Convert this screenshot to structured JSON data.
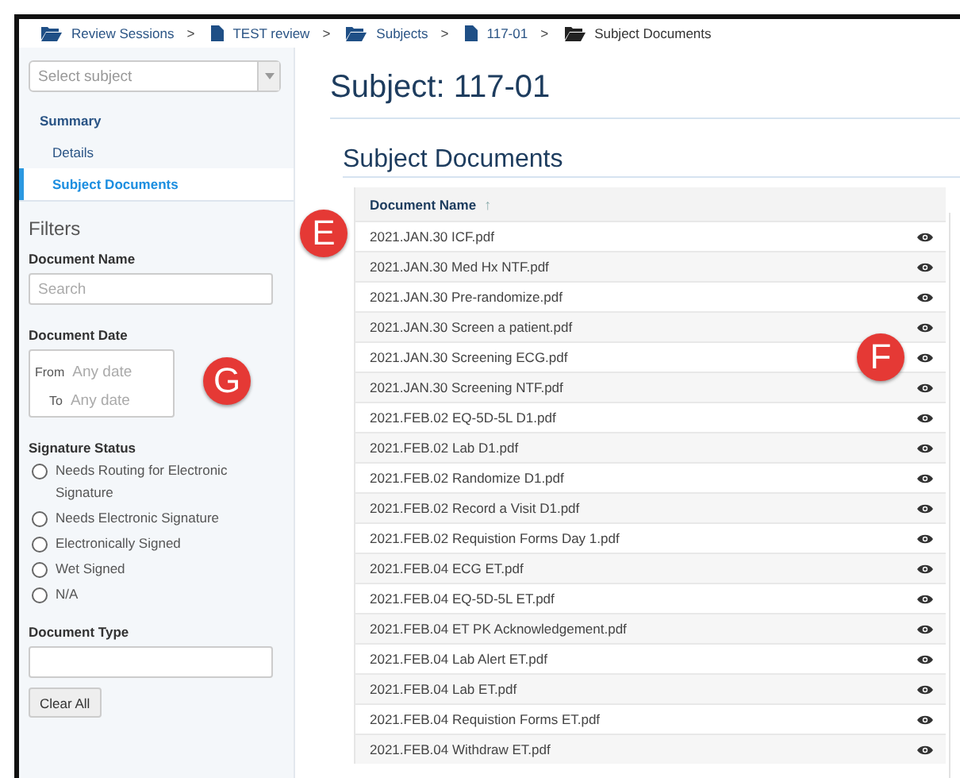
{
  "breadcrumbs": [
    {
      "label": "Review Sessions",
      "kind": "folder"
    },
    {
      "label": "TEST review",
      "kind": "file"
    },
    {
      "label": "Subjects",
      "kind": "folder"
    },
    {
      "label": "117-01",
      "kind": "file"
    },
    {
      "label": "Subject Documents",
      "kind": "current"
    }
  ],
  "separator": ">",
  "sidebar": {
    "subject_select": {
      "placeholder": "Select subject"
    },
    "nav": [
      {
        "label": "Summary",
        "kind": "heading",
        "selected": false
      },
      {
        "label": "Details",
        "kind": "item",
        "selected": false
      },
      {
        "label": "Subject Documents",
        "kind": "item",
        "selected": true
      }
    ],
    "filters_title": "Filters",
    "document_name": {
      "label": "Document Name",
      "placeholder": "Search"
    },
    "document_date": {
      "label": "Document Date",
      "from_label": "From",
      "from_placeholder": "Any date",
      "to_label": "To",
      "to_placeholder": "Any date"
    },
    "signature_status": {
      "label": "Signature Status",
      "options": [
        {
          "label": "Needs Routing for Electronic Signature",
          "selected": false
        },
        {
          "label": "Needs Electronic Signature",
          "selected": false
        },
        {
          "label": "Electronically Signed",
          "selected": false
        },
        {
          "label": "Wet Signed",
          "selected": false
        },
        {
          "label": "N/A",
          "selected": false
        }
      ]
    },
    "document_type": {
      "label": "Document Type"
    },
    "clear_button": "Clear All"
  },
  "main": {
    "title": "Subject: 117-01",
    "section_title": "Subject Documents",
    "table": {
      "columns": [
        "Document Name"
      ],
      "sort_icon": "↑",
      "rows": [
        "2021.JAN.30 ICF.pdf",
        "2021.JAN.30 Med Hx NTF.pdf",
        "2021.JAN.30 Pre-randomize.pdf",
        "2021.JAN.30 Screen a patient.pdf",
        "2021.JAN.30 Screening ECG.pdf",
        "2021.JAN.30 Screening NTF.pdf",
        "2021.FEB.02 EQ-5D-5L D1.pdf",
        "2021.FEB.02 Lab D1.pdf",
        "2021.FEB.02 Randomize D1.pdf",
        "2021.FEB.02 Record a Visit D1.pdf",
        "2021.FEB.02 Requistion Forms Day 1.pdf",
        "2021.FEB.04 ECG ET.pdf",
        "2021.FEB.04 EQ-5D-5L ET.pdf",
        "2021.FEB.04 ET PK Acknowledgement.pdf",
        "2021.FEB.04 Lab Alert ET.pdf",
        "2021.FEB.04 Lab ET.pdf",
        "2021.FEB.04 Requistion Forms ET.pdf",
        "2021.FEB.04 Withdraw ET.pdf"
      ]
    }
  },
  "callouts": [
    {
      "label": "E",
      "kind": "e"
    },
    {
      "label": "F",
      "kind": "f"
    },
    {
      "label": "G",
      "kind": "g"
    }
  ]
}
